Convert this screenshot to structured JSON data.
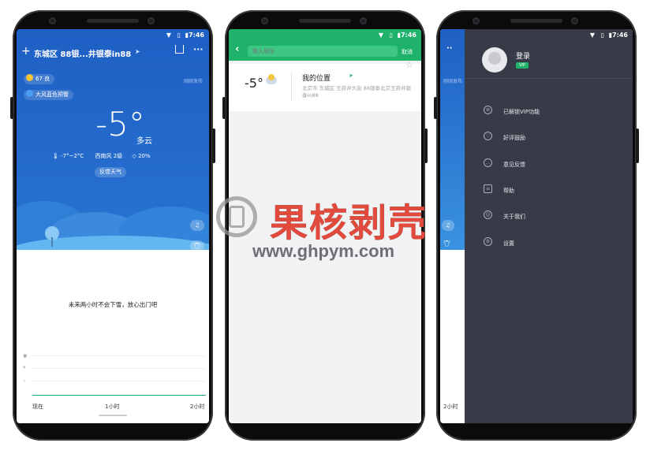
{
  "screen1": {
    "time": "7:46",
    "location": "东城区 88银...井银泰in88",
    "publish_time": "刚刚发布",
    "aqi": "67 良",
    "alert": "大风蓝色预警",
    "temp": "-5°",
    "condition": "多云",
    "temp_range": "-7°~2°C",
    "wind": "西南风 2级",
    "humidity": "20%",
    "feedback_btn": "反馈天气",
    "forecast_text": "未来两小时不会下雪，放心出门吧",
    "x_labels": [
      "现在",
      "1小时",
      "2小时"
    ]
  },
  "screen2": {
    "time": "7:46",
    "search_placeholder": "输入地址",
    "cancel": "取消",
    "card_temp": "-5°",
    "card_title": "我的位置",
    "card_addr": "北京市 东城区 王府井大街 88银泰北京王府井银泰in88"
  },
  "screen3": {
    "time": "7:46",
    "login": "登录",
    "vip_badge": "VIP",
    "menu": [
      "已解锁VIP功能",
      "好评鼓励",
      "意见反馈",
      "帮助",
      "关于我们",
      "设置"
    ],
    "peek_publish": "刚刚发布",
    "peek_x": "2小时"
  },
  "watermark": {
    "title": "果核剥壳",
    "url": "www.ghpym.com"
  },
  "colors": {
    "weather_blue": "#2873d2",
    "green": "#1fb26b",
    "drawer": "#363b47"
  }
}
